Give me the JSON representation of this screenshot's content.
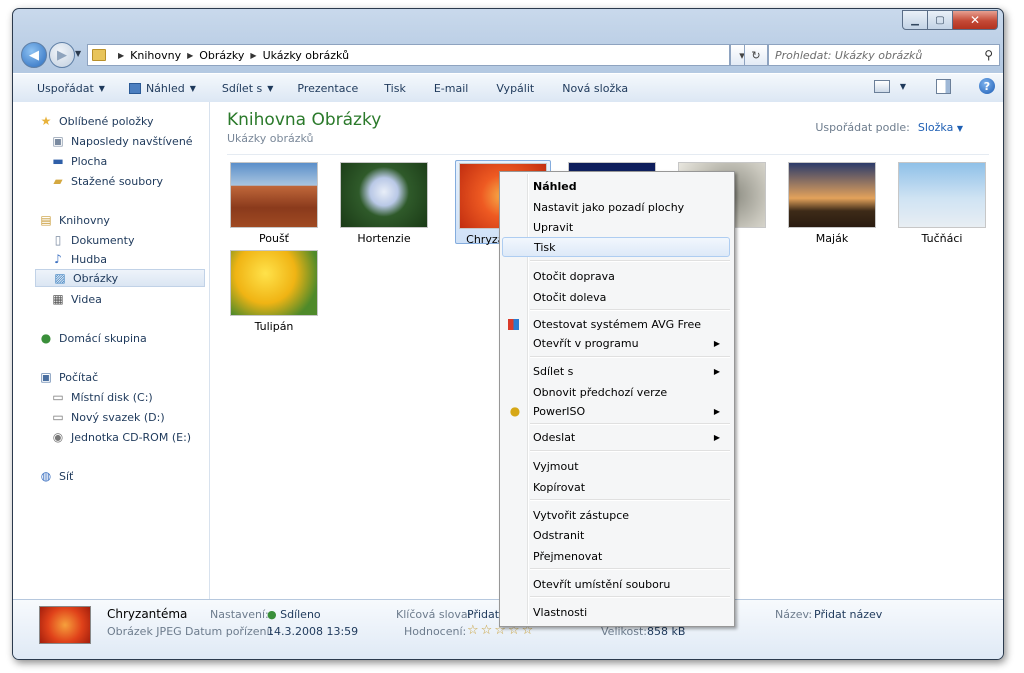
{
  "address": {
    "crumbs": [
      "Knihovny",
      "Obrázky",
      "Ukázky obrázků"
    ],
    "search_placeholder": "Prohledat: Ukázky obrázků"
  },
  "toolbar": {
    "items": [
      {
        "label": "Uspořádat",
        "dropdown": true
      },
      {
        "label": "Náhled",
        "dropdown": true
      },
      {
        "label": "Sdílet s",
        "dropdown": true
      },
      {
        "label": "Prezentace",
        "dropdown": false
      },
      {
        "label": "Tisk",
        "dropdown": false
      },
      {
        "label": "E-mail",
        "dropdown": false
      },
      {
        "label": "Vypálit",
        "dropdown": false
      },
      {
        "label": "Nová složka",
        "dropdown": false
      }
    ]
  },
  "nav": {
    "items": [
      {
        "label": "Oblíbené položky",
        "icon": "star-icon"
      },
      {
        "label": "Naposledy navštívené",
        "icon": "recent-places-icon"
      },
      {
        "label": "Plocha",
        "icon": "desktop-icon"
      },
      {
        "label": "Stažené soubory",
        "icon": "downloads-folder-icon"
      },
      {
        "label": "Knihovny",
        "icon": "libraries-icon"
      },
      {
        "label": "Dokumenty",
        "icon": "documents-icon"
      },
      {
        "label": "Hudba",
        "icon": "music-icon"
      },
      {
        "label": "Obrázky",
        "icon": "pictures-icon"
      },
      {
        "label": "Videa",
        "icon": "videos-icon"
      },
      {
        "label": "Domácí skupina",
        "icon": "homegroup-icon"
      },
      {
        "label": "Počítač",
        "icon": "computer-icon"
      },
      {
        "label": "Místní disk (C:)",
        "icon": "drive-icon"
      },
      {
        "label": "Nový svazek (D:)",
        "icon": "drive-icon"
      },
      {
        "label": "Jednotka CD-ROM (E:)",
        "icon": "cd-drive-icon"
      },
      {
        "label": "Síť",
        "icon": "network-icon"
      }
    ]
  },
  "library": {
    "title": "Knihovna Obrázky",
    "subtitle": "Ukázky obrázků",
    "arrange_label": "Uspořádat podle:",
    "arrange_value": "Složka"
  },
  "thumbs": [
    {
      "label": "Poušť"
    },
    {
      "label": "Hortenzie"
    },
    {
      "label": "Chryzantéma"
    },
    {
      "label": ""
    },
    {
      "label": ""
    },
    {
      "label": "Maják"
    },
    {
      "label": "Tučňáci"
    },
    {
      "label": "Tulipán"
    }
  ],
  "menu": {
    "items": [
      {
        "label": "Náhled",
        "submenu": false
      },
      {
        "label": "Nastavit jako pozadí plochy",
        "submenu": false
      },
      {
        "label": "Upravit",
        "submenu": false
      },
      {
        "label": "Tisk",
        "submenu": false
      },
      {
        "label": "Otočit doprava",
        "submenu": false
      },
      {
        "label": "Otočit doleva",
        "submenu": false
      },
      {
        "label": "Otestovat systémem AVG Free",
        "submenu": false
      },
      {
        "label": "Otevřít v programu",
        "submenu": true
      },
      {
        "label": "Sdílet s",
        "submenu": true
      },
      {
        "label": "Obnovit předchozí verze",
        "submenu": false
      },
      {
        "label": "PowerISO",
        "submenu": true
      },
      {
        "label": "Odeslat",
        "submenu": true
      },
      {
        "label": "Vyjmout",
        "submenu": false
      },
      {
        "label": "Kopírovat",
        "submenu": false
      },
      {
        "label": "Vytvořit zástupce",
        "submenu": false
      },
      {
        "label": "Odstranit",
        "submenu": false
      },
      {
        "label": "Přejmenovat",
        "submenu": false
      },
      {
        "label": "Otevřít umístění souboru",
        "submenu": false
      },
      {
        "label": "Vlastnosti",
        "submenu": false
      }
    ]
  },
  "details": {
    "name": "Chryzantéma",
    "type": "Obrázek JPEG",
    "settings_key": "Nastavení:",
    "settings_val": "Sdíleno",
    "date_key": "Datum pořízení:",
    "date_val": "14.3.2008 13:59",
    "keywords_key": "Klíčová slova:",
    "keywords_val": "Přidat",
    "rating_key": "Hodnocení:",
    "rating_stars": "☆☆☆☆☆",
    "size_key": "Velikost:",
    "size_val": "858 kB",
    "title_key": "Název:",
    "title_val": "Přidat název"
  },
  "colors": {
    "accent": "#1e5fb4",
    "library_title": "#2b7a2b",
    "text": "#1e395b"
  }
}
